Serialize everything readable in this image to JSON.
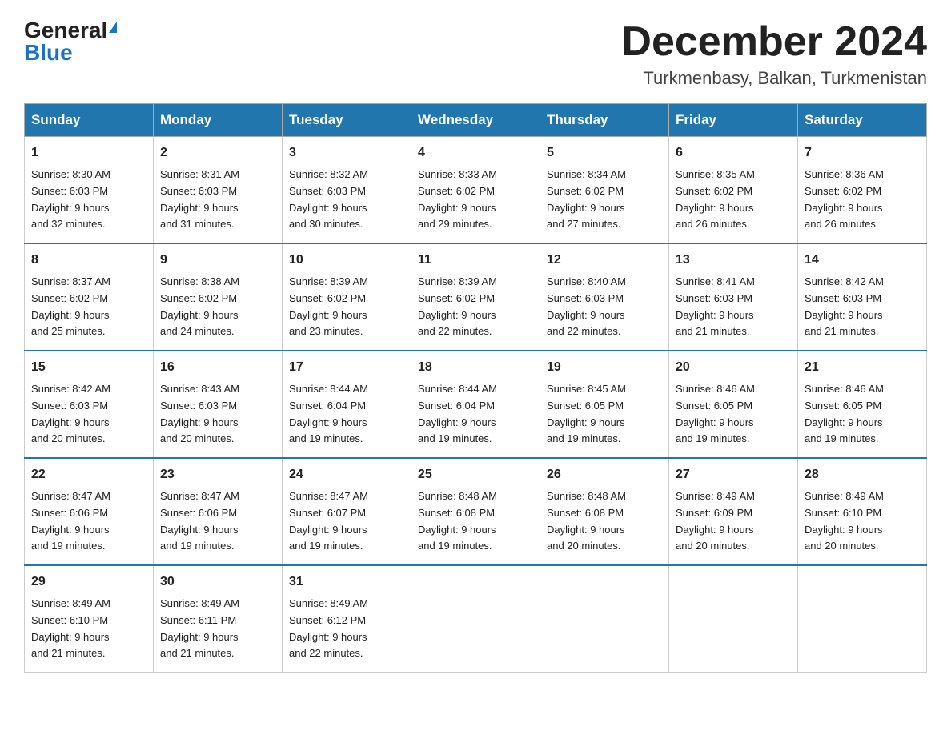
{
  "header": {
    "logo_general": "General",
    "logo_blue": "Blue",
    "month_title": "December 2024",
    "location": "Turkmenbasy, Balkan, Turkmenistan"
  },
  "days_of_week": [
    "Sunday",
    "Monday",
    "Tuesday",
    "Wednesday",
    "Thursday",
    "Friday",
    "Saturday"
  ],
  "weeks": [
    [
      {
        "day": "1",
        "sunrise": "8:30 AM",
        "sunset": "6:03 PM",
        "daylight": "9 hours and 32 minutes."
      },
      {
        "day": "2",
        "sunrise": "8:31 AM",
        "sunset": "6:03 PM",
        "daylight": "9 hours and 31 minutes."
      },
      {
        "day": "3",
        "sunrise": "8:32 AM",
        "sunset": "6:03 PM",
        "daylight": "9 hours and 30 minutes."
      },
      {
        "day": "4",
        "sunrise": "8:33 AM",
        "sunset": "6:02 PM",
        "daylight": "9 hours and 29 minutes."
      },
      {
        "day": "5",
        "sunrise": "8:34 AM",
        "sunset": "6:02 PM",
        "daylight": "9 hours and 27 minutes."
      },
      {
        "day": "6",
        "sunrise": "8:35 AM",
        "sunset": "6:02 PM",
        "daylight": "9 hours and 26 minutes."
      },
      {
        "day": "7",
        "sunrise": "8:36 AM",
        "sunset": "6:02 PM",
        "daylight": "9 hours and 26 minutes."
      }
    ],
    [
      {
        "day": "8",
        "sunrise": "8:37 AM",
        "sunset": "6:02 PM",
        "daylight": "9 hours and 25 minutes."
      },
      {
        "day": "9",
        "sunrise": "8:38 AM",
        "sunset": "6:02 PM",
        "daylight": "9 hours and 24 minutes."
      },
      {
        "day": "10",
        "sunrise": "8:39 AM",
        "sunset": "6:02 PM",
        "daylight": "9 hours and 23 minutes."
      },
      {
        "day": "11",
        "sunrise": "8:39 AM",
        "sunset": "6:02 PM",
        "daylight": "9 hours and 22 minutes."
      },
      {
        "day": "12",
        "sunrise": "8:40 AM",
        "sunset": "6:03 PM",
        "daylight": "9 hours and 22 minutes."
      },
      {
        "day": "13",
        "sunrise": "8:41 AM",
        "sunset": "6:03 PM",
        "daylight": "9 hours and 21 minutes."
      },
      {
        "day": "14",
        "sunrise": "8:42 AM",
        "sunset": "6:03 PM",
        "daylight": "9 hours and 21 minutes."
      }
    ],
    [
      {
        "day": "15",
        "sunrise": "8:42 AM",
        "sunset": "6:03 PM",
        "daylight": "9 hours and 20 minutes."
      },
      {
        "day": "16",
        "sunrise": "8:43 AM",
        "sunset": "6:03 PM",
        "daylight": "9 hours and 20 minutes."
      },
      {
        "day": "17",
        "sunrise": "8:44 AM",
        "sunset": "6:04 PM",
        "daylight": "9 hours and 19 minutes."
      },
      {
        "day": "18",
        "sunrise": "8:44 AM",
        "sunset": "6:04 PM",
        "daylight": "9 hours and 19 minutes."
      },
      {
        "day": "19",
        "sunrise": "8:45 AM",
        "sunset": "6:05 PM",
        "daylight": "9 hours and 19 minutes."
      },
      {
        "day": "20",
        "sunrise": "8:46 AM",
        "sunset": "6:05 PM",
        "daylight": "9 hours and 19 minutes."
      },
      {
        "day": "21",
        "sunrise": "8:46 AM",
        "sunset": "6:05 PM",
        "daylight": "9 hours and 19 minutes."
      }
    ],
    [
      {
        "day": "22",
        "sunrise": "8:47 AM",
        "sunset": "6:06 PM",
        "daylight": "9 hours and 19 minutes."
      },
      {
        "day": "23",
        "sunrise": "8:47 AM",
        "sunset": "6:06 PM",
        "daylight": "9 hours and 19 minutes."
      },
      {
        "day": "24",
        "sunrise": "8:47 AM",
        "sunset": "6:07 PM",
        "daylight": "9 hours and 19 minutes."
      },
      {
        "day": "25",
        "sunrise": "8:48 AM",
        "sunset": "6:08 PM",
        "daylight": "9 hours and 19 minutes."
      },
      {
        "day": "26",
        "sunrise": "8:48 AM",
        "sunset": "6:08 PM",
        "daylight": "9 hours and 20 minutes."
      },
      {
        "day": "27",
        "sunrise": "8:49 AM",
        "sunset": "6:09 PM",
        "daylight": "9 hours and 20 minutes."
      },
      {
        "day": "28",
        "sunrise": "8:49 AM",
        "sunset": "6:10 PM",
        "daylight": "9 hours and 20 minutes."
      }
    ],
    [
      {
        "day": "29",
        "sunrise": "8:49 AM",
        "sunset": "6:10 PM",
        "daylight": "9 hours and 21 minutes."
      },
      {
        "day": "30",
        "sunrise": "8:49 AM",
        "sunset": "6:11 PM",
        "daylight": "9 hours and 21 minutes."
      },
      {
        "day": "31",
        "sunrise": "8:49 AM",
        "sunset": "6:12 PM",
        "daylight": "9 hours and 22 minutes."
      },
      null,
      null,
      null,
      null
    ]
  ],
  "labels": {
    "sunrise_prefix": "Sunrise: ",
    "sunset_prefix": "Sunset: ",
    "daylight_prefix": "Daylight: "
  }
}
